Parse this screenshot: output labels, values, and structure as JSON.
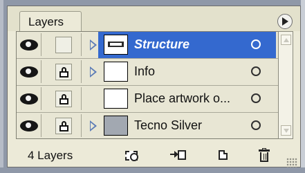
{
  "panel": {
    "tab_title": "Layers",
    "menu_icon": "panel-menu-icon"
  },
  "layers": [
    {
      "name": "Structure",
      "selected": true,
      "visible": true,
      "locked": false,
      "has_sublayers": true,
      "thumb": "white"
    },
    {
      "name": "Info",
      "selected": false,
      "visible": true,
      "locked": true,
      "has_sublayers": true,
      "thumb": "white"
    },
    {
      "name": "Place artwork o...",
      "selected": false,
      "visible": true,
      "locked": true,
      "has_sublayers": false,
      "thumb": "white"
    },
    {
      "name": "Tecno Silver",
      "selected": false,
      "visible": true,
      "locked": true,
      "has_sublayers": true,
      "thumb": "gray"
    }
  ],
  "footer": {
    "layer_count": "4 Layers"
  },
  "colors": {
    "panel_bg": "#ecead8",
    "selected_row": "#3469cf",
    "frame": "#8f98a8"
  }
}
